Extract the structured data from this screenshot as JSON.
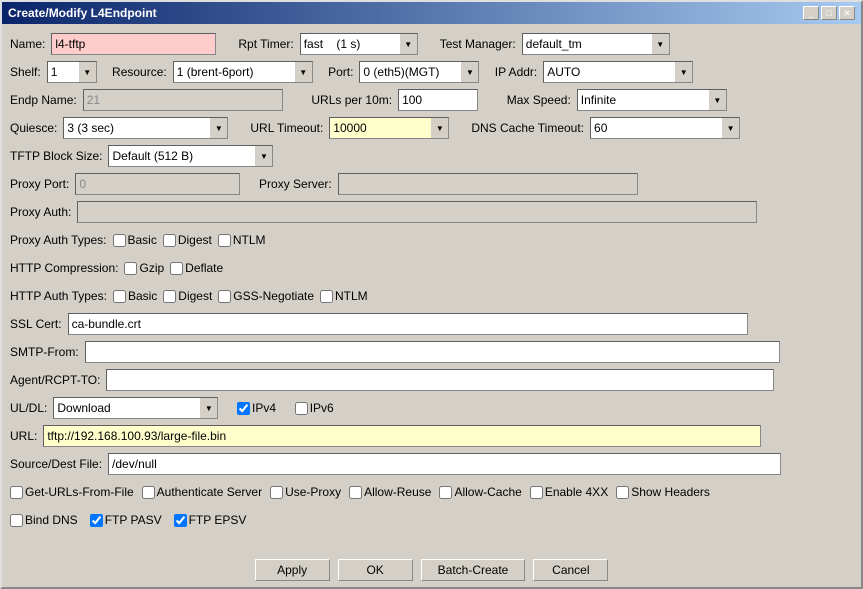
{
  "window": {
    "title": "Create/Modify L4Endpoint",
    "title_btn_min": "_",
    "title_btn_max": "□",
    "title_btn_close": "✕"
  },
  "form": {
    "name_label": "Name:",
    "name_value": "l4-tftp",
    "rpt_timer_label": "Rpt Timer:",
    "rpt_timer_value": "fast    (1 s)",
    "test_manager_label": "Test Manager:",
    "test_manager_value": "default_tm",
    "shelf_label": "Shelf:",
    "shelf_value": "1",
    "resource_label": "Resource:",
    "resource_value": "1 (brent-6port)",
    "port_label": "Port:",
    "port_value": "0 (eth5)(MGT)",
    "ip_addr_label": "IP Addr:",
    "ip_addr_value": "AUTO",
    "endp_name_label": "Endp Name:",
    "endp_name_value": "21",
    "urls_per_10m_label": "URLs per 10m:",
    "urls_per_10m_value": "100",
    "max_speed_label": "Max Speed:",
    "max_speed_value": "Infinite",
    "quiesce_label": "Quiesce:",
    "quiesce_value": "3 (3 sec)",
    "url_timeout_label": "URL Timeout:",
    "url_timeout_value": "10000",
    "dns_cache_label": "DNS Cache Timeout:",
    "dns_cache_value": "60",
    "tftp_block_label": "TFTP Block Size:",
    "tftp_block_value": "Default (512 B)",
    "proxy_port_label": "Proxy Port:",
    "proxy_port_value": "0",
    "proxy_server_label": "Proxy Server:",
    "proxy_server_value": "",
    "proxy_auth_label": "Proxy Auth:",
    "proxy_auth_value": "",
    "proxy_auth_types_label": "Proxy Auth Types:",
    "cb_basic_label": "Basic",
    "cb_digest_label": "Digest",
    "cb_ntlm_label": "NTLM",
    "http_compression_label": "HTTP Compression:",
    "cb_gzip_label": "Gzip",
    "cb_deflate_label": "Deflate",
    "http_auth_types_label": "HTTP Auth Types:",
    "cb_http_basic_label": "Basic",
    "cb_http_digest_label": "Digest",
    "cb_gss_label": "GSS-Negotiate",
    "cb_http_ntlm_label": "NTLM",
    "ssl_cert_label": "SSL Cert:",
    "ssl_cert_value": "ca-bundle.crt",
    "smtp_from_label": "SMTP-From:",
    "smtp_from_value": "",
    "agent_rcpt_label": "Agent/RCPT-TO:",
    "agent_rcpt_value": "",
    "ul_dl_label": "UL/DL:",
    "ul_dl_value": "Download",
    "cb_ipv4_label": "IPv4",
    "cb_ipv6_label": "IPv6",
    "url_label": "URL:",
    "url_value": "tftp://192.168.100.93/large-file.bin",
    "source_dest_label": "Source/Dest File:",
    "source_dest_value": "/dev/null",
    "cb_get_urls_label": "Get-URLs-From-File",
    "cb_auth_server_label": "Authenticate Server",
    "cb_use_proxy_label": "Use-Proxy",
    "cb_allow_reuse_label": "Allow-Reuse",
    "cb_allow_cache_label": "Allow-Cache",
    "cb_enable_4xx_label": "Enable 4XX",
    "cb_show_headers_label": "Show Headers",
    "cb_bind_dns_label": "Bind DNS",
    "cb_ftp_pasv_label": "FTP PASV",
    "cb_ftp_epsv_label": "FTP EPSV",
    "btn_apply": "Apply",
    "btn_ok": "OK",
    "btn_batch_create": "Batch-Create",
    "btn_cancel": "Cancel"
  }
}
